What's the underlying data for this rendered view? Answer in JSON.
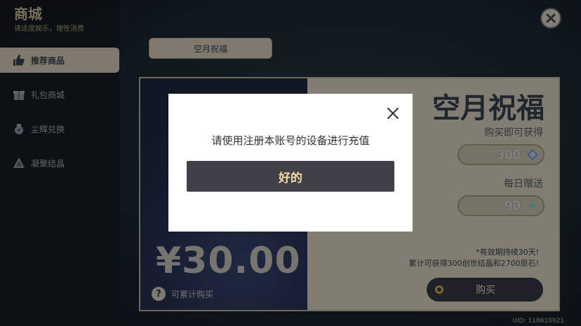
{
  "shop": {
    "title": "商城",
    "subtitle": "请适度娱乐，理性消费"
  },
  "sidebar": {
    "items": [
      {
        "label": "推荐商品",
        "icon": "thumbs-up-icon",
        "active": true
      },
      {
        "label": "礼包商城",
        "icon": "gift-icon",
        "active": false
      },
      {
        "label": "尘辉兑换",
        "icon": "bag-icon",
        "active": false
      },
      {
        "label": "凝聚结晶",
        "icon": "crystal-icon",
        "active": false
      }
    ]
  },
  "tab": {
    "label": "空月祝福"
  },
  "product": {
    "title": "空月祝福",
    "get_label": "购买即可获得",
    "get_amount": "300",
    "daily_label": "每日赠送",
    "daily_amount": "90",
    "note1": "*有效期持续30天!",
    "note2": "累计可获得300创世结晶和2700原石!",
    "buy_label": "购买",
    "price": "¥30.00",
    "accumulate_label": "可累计购买",
    "help_glyph": "?"
  },
  "uid": "UID: 118610921",
  "dialog": {
    "message": "请使用注册本账号的设备进行充值",
    "ok_label": "好的"
  },
  "colors": {
    "accent_gold": "#f1d9a6",
    "panel_cream": "#ebe3d2",
    "dark_button": "#3f4048"
  }
}
